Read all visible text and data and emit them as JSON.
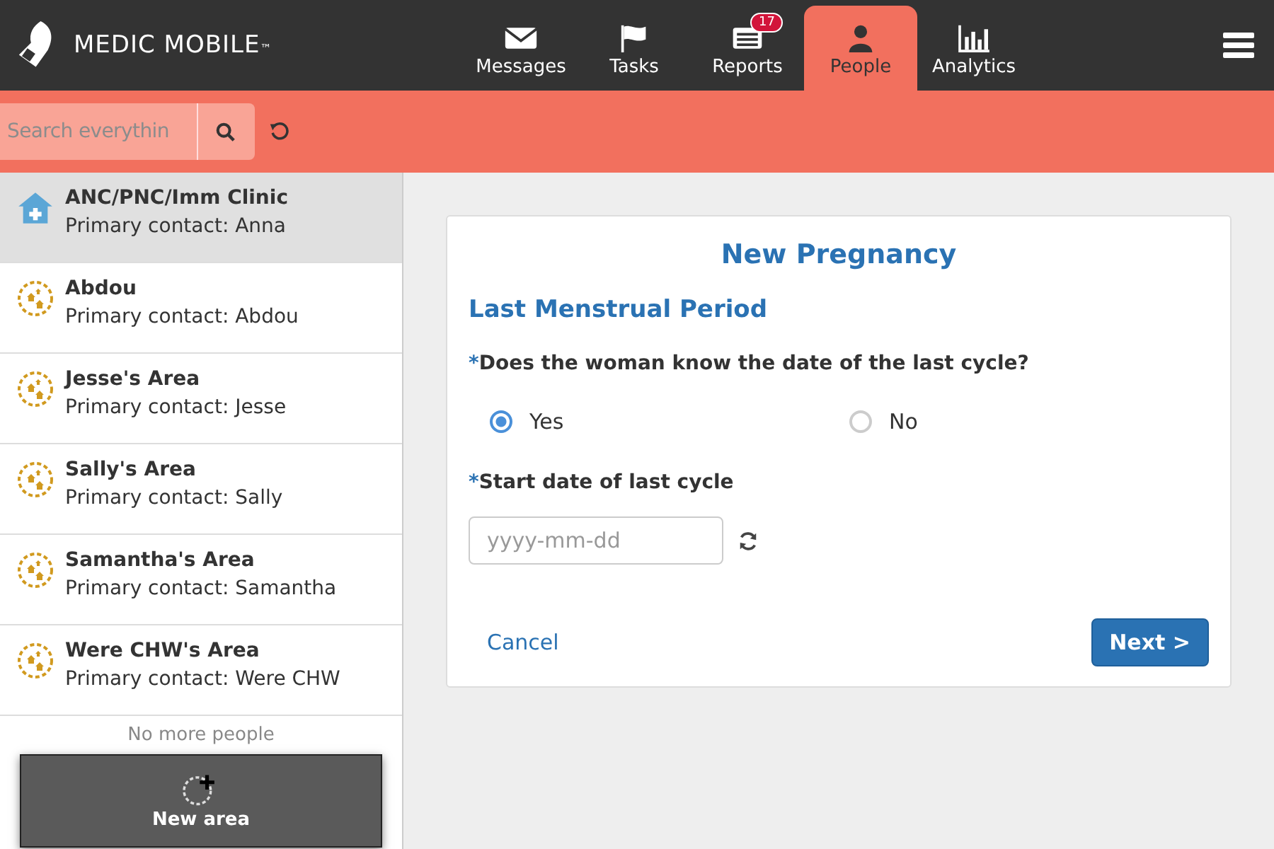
{
  "header": {
    "brand": "MEDIC MOBILE",
    "trademark": "™",
    "tabs": [
      {
        "label": "Messages",
        "kind": "envelope",
        "selected": false
      },
      {
        "label": "Tasks",
        "kind": "flag",
        "selected": false
      },
      {
        "label": "Reports",
        "kind": "list",
        "selected": false,
        "badge": "17"
      },
      {
        "label": "People",
        "kind": "person",
        "selected": true
      },
      {
        "label": "Analytics",
        "kind": "chart",
        "selected": false
      }
    ]
  },
  "search": {
    "placeholder": "Search everythin"
  },
  "sidebar": {
    "items": [
      {
        "kind": "clinic",
        "name": "ANC/PNC/Imm Clinic",
        "contact": "Primary contact: Anna",
        "selected": true
      },
      {
        "kind": "area",
        "name": "Abdou",
        "contact": "Primary contact: Abdou",
        "selected": false
      },
      {
        "kind": "area",
        "name": "Jesse's Area",
        "contact": "Primary contact: Jesse",
        "selected": false
      },
      {
        "kind": "area",
        "name": "Sally's Area",
        "contact": "Primary contact: Sally",
        "selected": false
      },
      {
        "kind": "area",
        "name": "Samantha's Area",
        "contact": "Primary contact: Samantha",
        "selected": false
      },
      {
        "kind": "area",
        "name": "Were CHW's Area",
        "contact": "Primary contact: Were CHW",
        "selected": false
      }
    ],
    "footer": "No more people",
    "drag_label": "New area"
  },
  "form": {
    "title": "New Pregnancy",
    "section": "Last Menstrual Period",
    "question": "Does the woman know the date of the last cycle?",
    "required_mark": "*",
    "options": [
      {
        "label": "Yes",
        "selected": true
      },
      {
        "label": "No",
        "selected": false
      }
    ],
    "date_label": "Start date of last cycle",
    "date_placeholder": "yyyy-mm-dd",
    "cancel": "Cancel",
    "next": "Next >"
  }
}
